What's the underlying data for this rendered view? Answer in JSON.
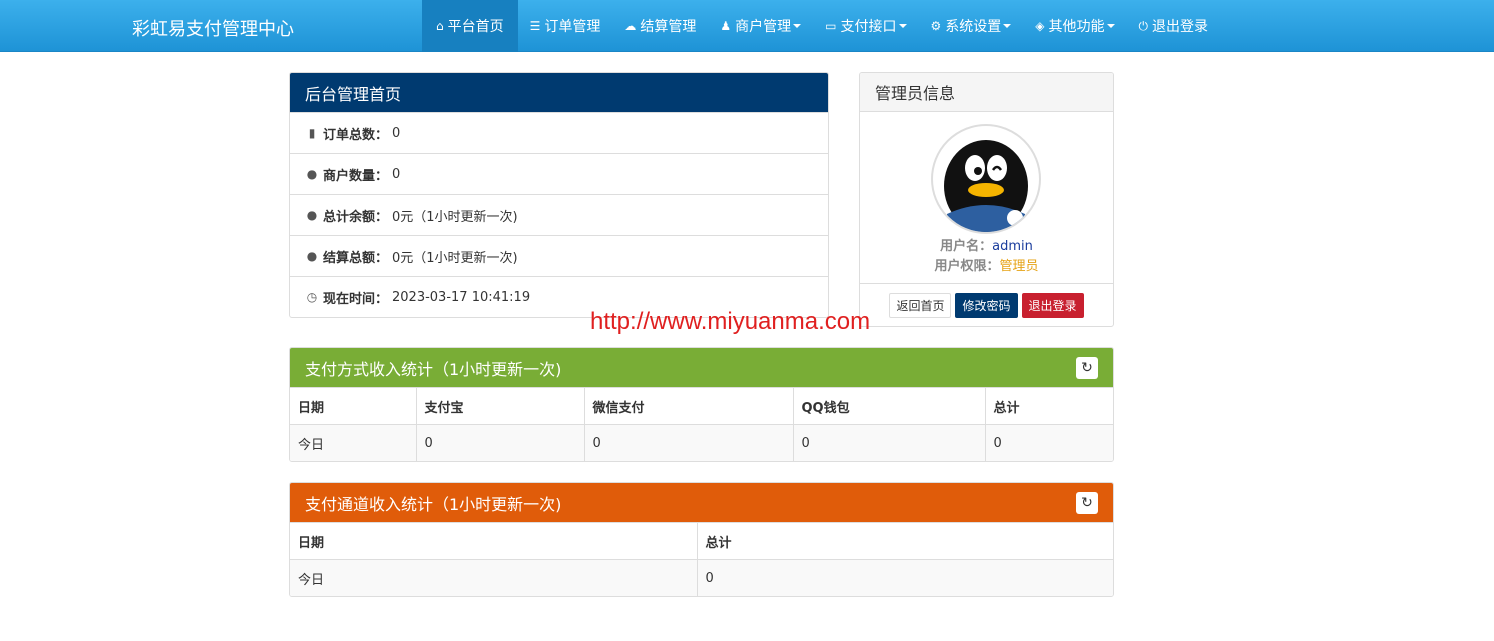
{
  "brand": "彩虹易支付管理中心",
  "nav": [
    {
      "label": "平台首页",
      "icon": "home-icon",
      "active": true,
      "caret": false
    },
    {
      "label": "订单管理",
      "icon": "list-icon",
      "caret": false
    },
    {
      "label": "结算管理",
      "icon": "cloud-icon",
      "caret": false
    },
    {
      "label": "商户管理",
      "icon": "user-icon",
      "caret": true
    },
    {
      "label": "支付接口",
      "icon": "credit-card-icon",
      "caret": true
    },
    {
      "label": "系统设置",
      "icon": "gear-icon",
      "caret": true
    },
    {
      "label": "其他功能",
      "icon": "cube-icon",
      "caret": true
    },
    {
      "label": "退出登录",
      "icon": "power-icon",
      "caret": false
    }
  ],
  "main": {
    "title": "后台管理首页",
    "rows": [
      {
        "icon": "bar-chart-icon",
        "label": "订单总数：",
        "value": "0"
      },
      {
        "icon": "drop-icon",
        "label": "商户数量：",
        "value": "0"
      },
      {
        "icon": "drop-icon",
        "label": "总计余额：",
        "value": "0元（1小时更新一次)"
      },
      {
        "icon": "drop-icon",
        "label": "结算总额：",
        "value": "0元（1小时更新一次)"
      },
      {
        "icon": "clock-icon",
        "label": "现在时间：",
        "value": "2023-03-17 10:41:19"
      }
    ]
  },
  "admin": {
    "title": "管理员信息",
    "username_label": "用户名：",
    "username": "admin",
    "role_label": "用户权限：",
    "role": "管理员",
    "btn_home": "返回首页",
    "btn_password": "修改密码",
    "btn_logout": "退出登录"
  },
  "pay_stats": {
    "title": "支付方式收入统计（1小时更新一次)",
    "headers": [
      "日期",
      "支付宝",
      "微信支付",
      "QQ钱包",
      "总计"
    ],
    "rows": [
      [
        "今日",
        "0",
        "0",
        "0",
        "0"
      ]
    ]
  },
  "channel_stats": {
    "title": "支付通道收入统计（1小时更新一次)",
    "headers": [
      "日期",
      "总计"
    ],
    "rows": [
      [
        "今日",
        "0"
      ]
    ]
  },
  "watermark": "http://www.miyuanma.com",
  "colors": {
    "nav": "#2ba3e4",
    "main_head": "#003a70",
    "pay_head": "#79ad36",
    "channel_head": "#e05c0a"
  }
}
